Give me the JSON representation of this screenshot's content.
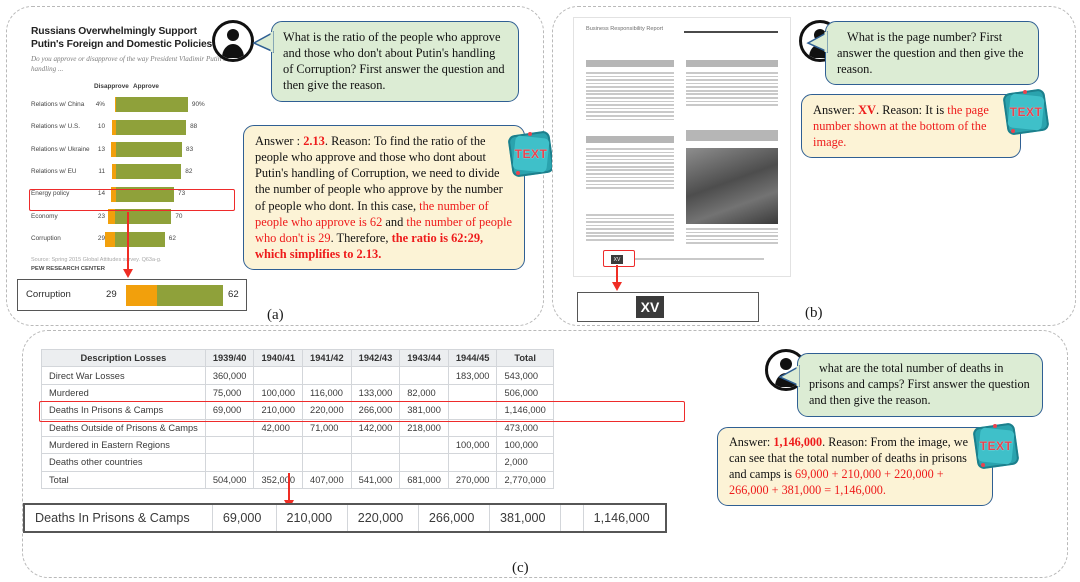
{
  "panels": {
    "a": {
      "caption": "(a)"
    },
    "b": {
      "caption": "(b)"
    },
    "c": {
      "caption": "(c)"
    }
  },
  "panel_a": {
    "question": "What is the ratio of the people who approve and those who don't about Putin's handling of Corruption? First answer the question and then give the reason.",
    "answer": {
      "prefix": "Answer : ",
      "value": "2.13",
      "seg1": ". Reason: To find the ratio of the people who approve and those who dont about Putin's handling of Corruption, we need to divide the number of people who approve by the number of people who dont. In this case, ",
      "red1": "the number of people who approve is 62",
      "seg2": " and ",
      "red2": "the number of people who don't is 29",
      "seg3": ". Therefore, ",
      "bold_red": "the ratio is 62:29, which simplifies to 2.13."
    },
    "zoom_row": {
      "label": "Corruption",
      "disapprove": "29",
      "approve": "62"
    },
    "chart_data": {
      "type": "bar",
      "title": "Russians Overwhelmingly Support Putin's Foreign and Domestic Policies",
      "subtitle": "Do you approve or disapprove of the way President Vladimir Putin is handling ...",
      "col_headers": [
        "Disapprove",
        "Approve"
      ],
      "categories": [
        "Relations w/ China",
        "Relations w/ U.S.",
        "Relations w/ Ukraine",
        "Relations w/ EU",
        "Energy policy",
        "Economy",
        "Corruption"
      ],
      "series": [
        {
          "name": "Disapprove",
          "values": [
            4,
            10,
            13,
            11,
            14,
            23,
            29
          ],
          "color": "#f2a00c"
        },
        {
          "name": "Approve",
          "values": [
            90,
            88,
            83,
            82,
            73,
            70,
            62
          ],
          "color": "#8fa13a"
        }
      ],
      "value_labels_disapprove": [
        "4%",
        "10",
        "13",
        "11",
        "14",
        "23",
        "29"
      ],
      "value_labels_approve": [
        "90%",
        "88",
        "83",
        "82",
        "73",
        "70",
        "62"
      ],
      "highlighted_category": "Corruption",
      "source": "Source: Spring 2015 Global Attitudes survey. Q63a-g.",
      "organization": "PEW RESEARCH CENTER",
      "xlabel": "",
      "ylabel": "",
      "grid": false,
      "legend_position": "top"
    }
  },
  "panel_b": {
    "question": "What is the page number? First answer the question and then give the reason.",
    "answer": {
      "prefix": "Answer: ",
      "value": "XV",
      "seg1": ". Reason: It is ",
      "red1": "the page number shown at the bottom of the image."
    },
    "document": {
      "title": "Business Responsibility Report",
      "page_number": "XV"
    },
    "zoom_box": {
      "page_number": "XV"
    }
  },
  "panel_c": {
    "question": "what are the total number of deaths in prisons and camps? First answer the question and then give the reason.",
    "answer": {
      "prefix": "Answer: ",
      "value": "1,146,000",
      "seg1": ". Reason: From the image, we can see that the total number of deaths in prisons and camps is ",
      "red1": "69,000 + 210,000 + 220,000 + 266,000 + 381,000 = 1,146,000."
    },
    "table": {
      "headers": [
        "Description Losses",
        "1939/40",
        "1940/41",
        "1941/42",
        "1942/43",
        "1943/44",
        "1944/45",
        "Total"
      ],
      "rows": [
        [
          "Direct War Losses",
          "360,000",
          "",
          "",
          "",
          "",
          "183,000",
          "543,000"
        ],
        [
          "Murdered",
          "75,000",
          "100,000",
          "116,000",
          "133,000",
          "82,000",
          "",
          "506,000"
        ],
        [
          "Deaths In Prisons & Camps",
          "69,000",
          "210,000",
          "220,000",
          "266,000",
          "381,000",
          "",
          "1,146,000"
        ],
        [
          "Deaths Outside of Prisons & Camps",
          "",
          "42,000",
          "71,000",
          "142,000",
          "218,000",
          "",
          "473,000"
        ],
        [
          "Murdered in Eastern Regions",
          "",
          "",
          "",
          "",
          "",
          "100,000",
          "100,000"
        ],
        [
          "Deaths other countries",
          "",
          "",
          "",
          "",
          "",
          "",
          "2,000"
        ],
        [
          "Total",
          "504,000",
          "352,000",
          "407,000",
          "541,000",
          "681,000",
          "270,000",
          "2,770,000"
        ]
      ],
      "highlighted_row_index": 2
    },
    "zoom_row": [
      "Deaths In Prisons & Camps",
      "69,000",
      "210,000",
      "220,000",
      "266,000",
      "381,000",
      "",
      "1,146,000"
    ]
  },
  "icons": {
    "avatar": "user-avatar-icon",
    "text_badge": "TEXT"
  },
  "colors": {
    "approve_bar": "#8fa13a",
    "disapprove_bar": "#f2a00c",
    "highlight": "#ee2b2b",
    "bubble_question": "#dcecd4",
    "bubble_answer": "#fcf3d6",
    "bubble_border": "#2f5f93"
  }
}
